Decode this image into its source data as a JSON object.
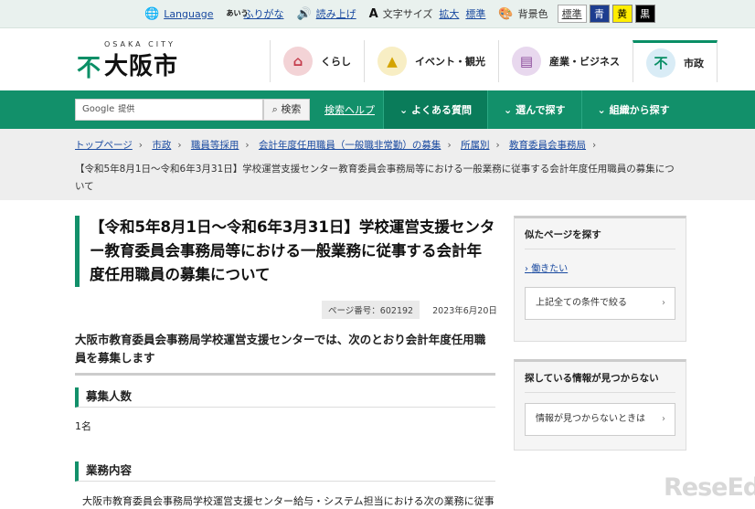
{
  "utility": {
    "language": "Language",
    "furigana": "ふりがな",
    "read_aloud": "読み上げ",
    "text_size_label": "文字サイズ",
    "text_size_enlarge": "拡大",
    "text_size_standard": "標準",
    "bg_label": "背景色",
    "bg_standard": "標準",
    "bg_blue": "青",
    "bg_yellow": "黄",
    "bg_black": "黒",
    "furigana_icon_text": "あいう"
  },
  "logo": {
    "small": "OSAKA CITY",
    "name": "大阪市"
  },
  "gnav": [
    {
      "label": "くらし",
      "icon": "house-icon",
      "color": "#f3d3d6",
      "active": false
    },
    {
      "label": "イベント・観光",
      "icon": "event-icon",
      "color": "#f8eec4",
      "active": false
    },
    {
      "label": "産業・ビジネス",
      "icon": "building-icon",
      "color": "#e8d8ee",
      "active": false
    },
    {
      "label": "市政",
      "icon": "city-emblem-icon",
      "color": "#d9ecf6",
      "active": true
    }
  ],
  "search": {
    "provider": "Google",
    "placeholder": "提供",
    "button": "検索",
    "help": "検索ヘルプ"
  },
  "bnav": [
    {
      "label": "よくある質問"
    },
    {
      "label": "選んで探す"
    },
    {
      "label": "組織から探す"
    }
  ],
  "breadcrumb": {
    "items": [
      "トップページ",
      "市政",
      "職員等採用",
      "会計年度任用職員（一般職非常勤）の募集",
      "所属別",
      "教育委員会事務局"
    ],
    "current": "【令和5年8月1日～令和6年3月31日】学校運営支援センター教育委員会事務局等における一般業務に従事する会計年度任用職員の募集について"
  },
  "page": {
    "title": "【令和5年8月1日～令和6年3月31日】学校運営支援センター教育委員会事務局等における一般業務に従事する会計年度任用職員の募集について",
    "page_id": "ページ番号：602192",
    "date": "2023年6月20日",
    "lead": "大阪市教育委員会事務局学校運営支援センターでは、次のとおり会計年度任用職員を募集します",
    "sections": [
      {
        "heading": "募集人数",
        "text": "1名"
      },
      {
        "heading": "業務内容",
        "text": "大阪市教育委員会事務局学校運営支援センター給与・システム担当における次の業務に従事"
      }
    ]
  },
  "sidebar": {
    "similar": {
      "title": "似たページを探す",
      "link": "働きたい",
      "button": "上記全ての条件で絞る"
    },
    "notfound": {
      "title": "探している情報が見つからない",
      "button": "情報が見つからないときは"
    }
  },
  "watermark": "ReseEd",
  "colors": {
    "brand_green": "#12906a",
    "link_blue": "#1a4aa0"
  }
}
